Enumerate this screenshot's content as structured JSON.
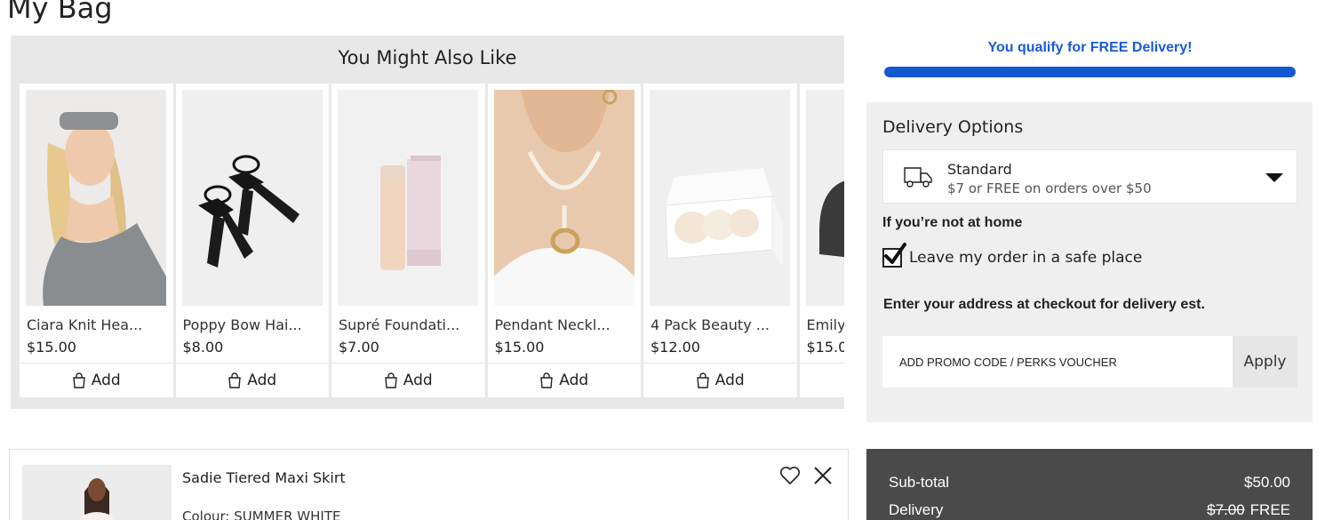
{
  "page": {
    "title": "My Bag"
  },
  "recommendations": {
    "title": "You Might Also Like",
    "add_label": "Add",
    "items": [
      {
        "name": "Ciara Knit Hea...",
        "price": "$15.00"
      },
      {
        "name": "Poppy Bow Hai...",
        "price": "$8.00"
      },
      {
        "name": "Supré Foundati...",
        "price": "$7.00"
      },
      {
        "name": "Pendant Neckl...",
        "price": "$15.00"
      },
      {
        "name": "4 Pack Beauty ...",
        "price": "$12.00"
      },
      {
        "name": "Emily",
        "price": "$15.0"
      }
    ]
  },
  "delivery_banner": {
    "message": "You qualify for FREE Delivery!",
    "progress": 1.0
  },
  "delivery_options": {
    "title": "Delivery Options",
    "selected": {
      "name": "Standard",
      "description": "$7 or FREE on orders over $50"
    },
    "not_home_heading": "If you’re not at home",
    "safe_place_label": "Leave my order in a safe place",
    "safe_place_checked": true,
    "address_note": "Enter your address at checkout for delivery est."
  },
  "promo": {
    "placeholder": "ADD PROMO CODE / PERKS VOUCHER",
    "apply_label": "Apply"
  },
  "bag_item": {
    "name": "Sadie Tiered Maxi Skirt",
    "colour": "Colour: SUMMER WHITE"
  },
  "summary": {
    "subtotal_label": "Sub-total",
    "subtotal_value": "$50.00",
    "delivery_label": "Delivery",
    "delivery_original": "$7.00",
    "delivery_value": "FREE"
  },
  "colors": {
    "accent_blue": "#1357d1",
    "summary_bg": "#4a4a4a"
  }
}
